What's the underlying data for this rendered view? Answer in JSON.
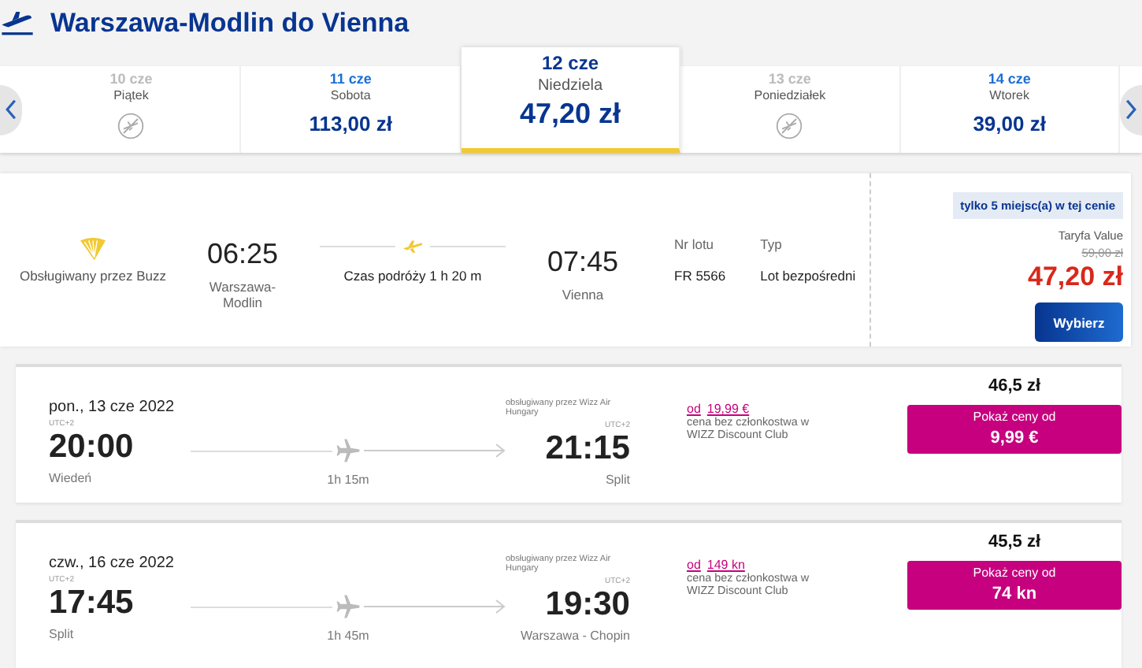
{
  "title": "Warszawa-Modlin do Vienna",
  "dates": [
    {
      "date": "10 cze",
      "day": "Piątek",
      "kind": "unavailable",
      "selected": false
    },
    {
      "date": "11 cze",
      "day": "Sobota",
      "kind": "available",
      "price": "113,00 zł",
      "selected": false
    },
    {
      "date": "12 cze",
      "day": "Niedziela",
      "kind": "available",
      "price": "47,20 zł",
      "selected": true
    },
    {
      "date": "13 cze",
      "day": "Poniedziałek",
      "kind": "unavailable",
      "selected": false
    },
    {
      "date": "14 cze",
      "day": "Wtorek",
      "kind": "available",
      "price": "39,00 zł",
      "selected": false
    }
  ],
  "flight": {
    "operator": "Obsługiwany przez Buzz",
    "depart_time": "06:25",
    "depart_city": "Warszawa-Modlin",
    "duration": "Czas podróży 1 h 20 m",
    "arrive_time": "07:45",
    "arrive_city": "Vienna",
    "flight_no_label": "Nr lotu",
    "flight_no": "FR 5566",
    "type_label": "Typ",
    "type": "Lot bezpośredni",
    "seats_badge": "tylko 5 miejsc(a) w tej cenie",
    "fare": "Taryfa Value",
    "old_price": "59,00 zł",
    "price": "47,20 zł",
    "button": "Wybierz"
  },
  "offers": [
    {
      "date": "pon., 13 cze 2022",
      "operator": "obsługiwany przez Wizz Air Hungary",
      "depart_tz": "UTC+2",
      "depart_time": "20:00",
      "depart_city": "Wiedeń",
      "duration": "1h 15m",
      "arrive_tz": "UTC+2",
      "arrive_time": "21:15",
      "arrive_city": "Split",
      "from_label": "od",
      "from_price": "19,99 €",
      "note": "cena bez członkostwa w WIZZ Discount Club",
      "total": "46,5 zł",
      "button_label": "Pokaż ceny od",
      "button_price": "9,99 €"
    },
    {
      "date": "czw., 16 cze 2022",
      "operator": "obsługiwany przez Wizz Air Hungary",
      "depart_tz": "UTC+2",
      "depart_time": "17:45",
      "depart_city": "Split",
      "duration": "1h 45m",
      "arrive_tz": "UTC+2",
      "arrive_time": "19:30",
      "arrive_city": "Warszawa - Chopin",
      "from_label": "od",
      "from_price": "149 kn",
      "note": "cena bez członkostwa w WIZZ Discount Club",
      "total": "45,5 zł",
      "button_label": "Pokaż ceny od",
      "button_price": "74 kn"
    }
  ]
}
